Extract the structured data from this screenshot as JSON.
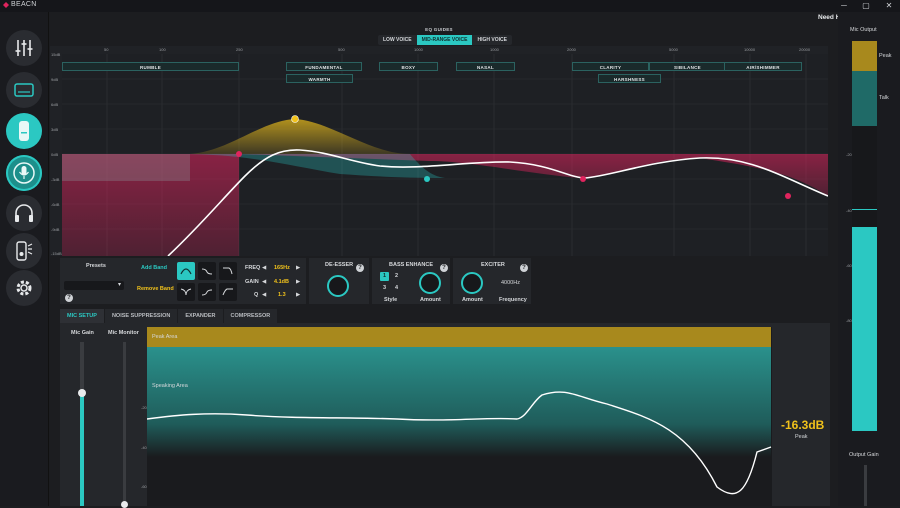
{
  "app": {
    "title": "BEACN"
  },
  "window": {
    "minimize": "─",
    "maximize": "▢",
    "close": "✕"
  },
  "header": {
    "need_help": "Need Help?"
  },
  "sidebar": {
    "items": [
      {
        "name": "mixer",
        "icon": "sliders-icon"
      },
      {
        "name": "devices",
        "icon": "device-icon"
      },
      {
        "name": "mic",
        "icon": "mic-device-icon"
      },
      {
        "name": "mic-settings",
        "icon": "mic-icon"
      },
      {
        "name": "headphones",
        "icon": "headphones-icon"
      },
      {
        "name": "lighting",
        "icon": "lighting-icon"
      },
      {
        "name": "settings",
        "icon": "gear-icon"
      }
    ]
  },
  "eq_guides": {
    "label": "EQ GUIDES",
    "tabs": [
      "LOW VOICE",
      "MID-RANGE VOICE",
      "HIGH VOICE"
    ],
    "selected": "MID-RANGE VOICE"
  },
  "eq_graph": {
    "freq_ticks": [
      "20",
      "50",
      "100",
      "250",
      "500",
      "1000",
      "2000",
      "5000",
      "10000",
      "20000"
    ],
    "gain_ticks": [
      "15dB",
      "12dB",
      "9dB",
      "6dB",
      "3dB",
      "0dB",
      "-3dB",
      "-6dB",
      "-9dB",
      "-12dB",
      "-15dB"
    ],
    "bands": [
      "RUMBLE",
      "FUNDAMENTAL",
      "WARMTH",
      "BOXY",
      "NASAL",
      "CLARITY",
      "HARSHNESS",
      "SIBILANCE",
      "AIR/SHIMMER"
    ]
  },
  "presets": {
    "label": "Presets",
    "dropdown_arrow": "▾",
    "help": "?"
  },
  "band_buttons": {
    "add": "Add Band",
    "remove": "Remove Band"
  },
  "band_params": {
    "freq_label": "FREQ",
    "freq_value": "165Hz",
    "gain_label": "GAIN",
    "gain_value": "4.1dB",
    "q_label": "Q",
    "q_value": "1.3",
    "left_arrow": "◀",
    "right_arrow": "▶"
  },
  "de_esser": {
    "label": "DE-ESSER",
    "help": "?"
  },
  "bass_enhance": {
    "label": "BASS ENHANCE",
    "help": "?",
    "styles": [
      "1",
      "2",
      "3",
      "4"
    ],
    "selected_style": "1",
    "style_label": "Style",
    "amount_label": "Amount"
  },
  "exciter": {
    "label": "EXCITER",
    "help": "?",
    "frequency": "4000Hz",
    "amount_label": "Amount",
    "frequency_label": "Frequency"
  },
  "mic_tabs": [
    "MIC SETUP",
    "NOISE SUPPRESSION",
    "EXPANDER",
    "COMPRESSOR"
  ],
  "mic_tab_selected": "MIC SETUP",
  "mic_setup": {
    "mic_gain_label": "Mic Gain",
    "mic_monitor_label": "Mic Monitor",
    "peak_area_label": "Peak Area",
    "speaking_area_label": "Speaking Area",
    "scale": [
      "-20",
      "-40",
      "-60"
    ],
    "peak_value": "-16.3dB",
    "peak_label": "Peak"
  },
  "mic_output": {
    "label": "Mic Output",
    "peak_label": "Peak",
    "talk_label": "Talk",
    "scale": [
      "-20",
      "-40",
      "-60",
      "-80"
    ],
    "output_gain_label": "Output Gain"
  },
  "colors": {
    "accent": "#2bc8c2",
    "peak": "#f1c21b",
    "red": "#e0245e"
  }
}
